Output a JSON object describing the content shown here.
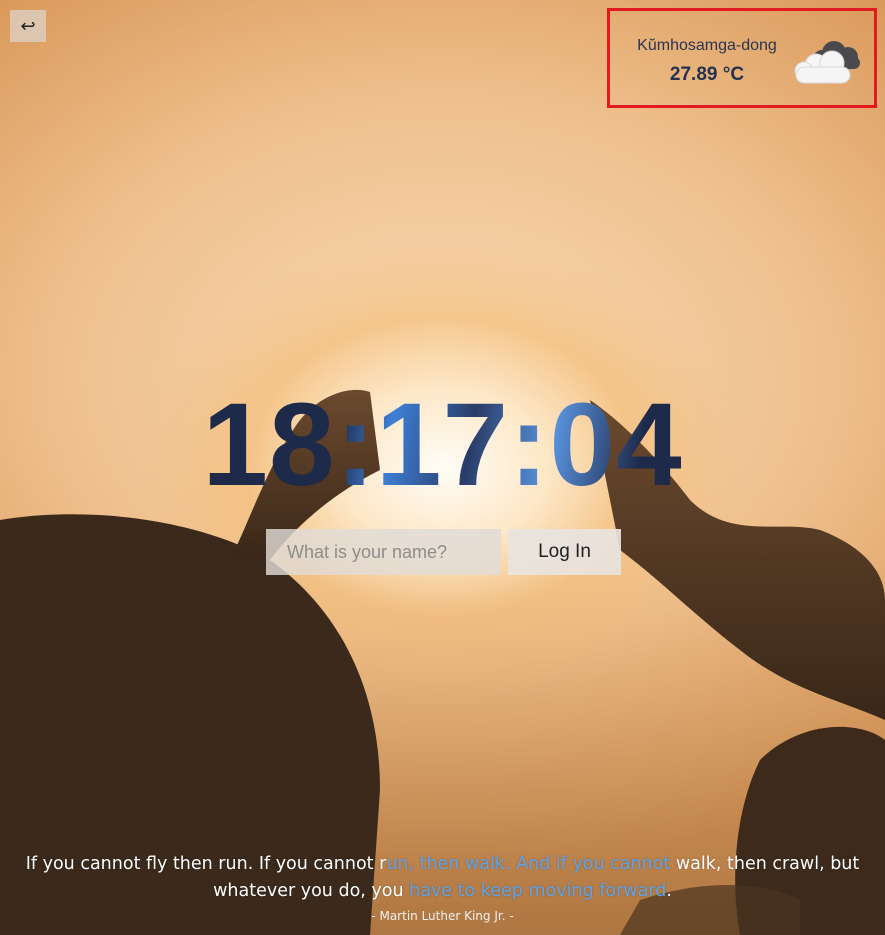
{
  "back_button": {
    "icon": "return-arrow-icon",
    "glyph": "↩"
  },
  "weather": {
    "city": "Kŭmhosamga-dong",
    "temperature": "27.89 °C",
    "icon": "cloud-icon"
  },
  "clock": {
    "time": "18:17:04"
  },
  "login": {
    "placeholder": "What is your name?",
    "value": "",
    "button_label": "Log In"
  },
  "quote": {
    "part1": "If you cannot fly then run. If you cannot r",
    "part2": "un, then walk. And if you cannot",
    "part3": " walk, then crawl, but whatever you do, you",
    "part4": " have to keep moving forward",
    "part5": ".",
    "author": "- Martin Luther King Jr. -"
  },
  "colors": {
    "highlight": "#5ea3e8",
    "weather_border": "#e21b23",
    "clock_text": "#1e2a4a"
  }
}
